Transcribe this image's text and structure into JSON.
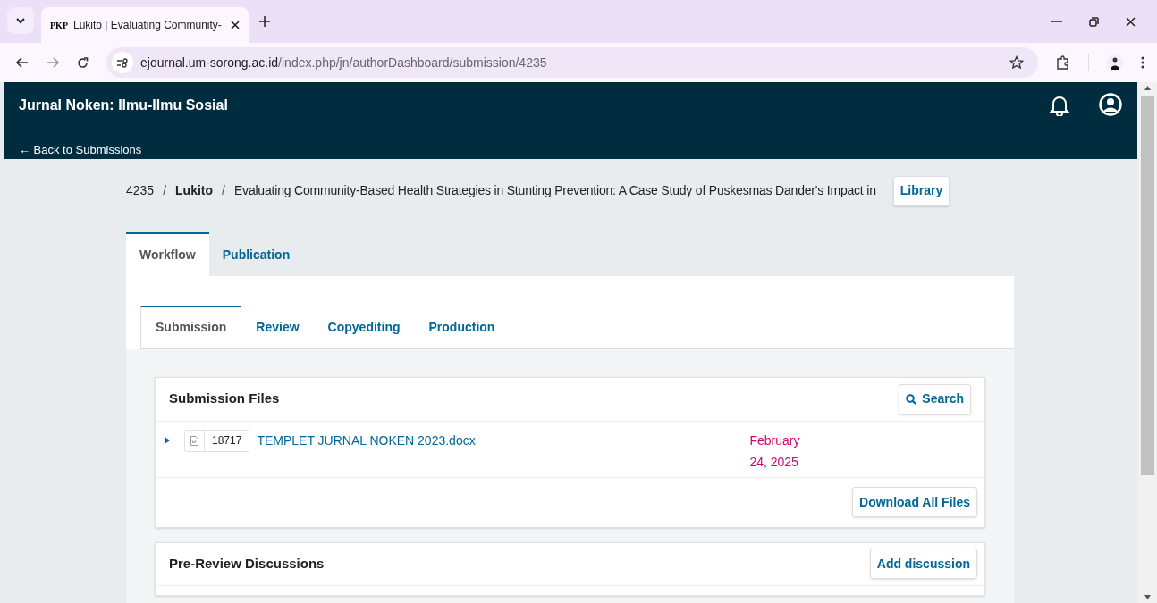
{
  "browser": {
    "tab_title": "Lukito | Evaluating Community-",
    "favicon_text": "PKP",
    "url_host": "ejournal.um-sorong.ac.id",
    "url_path": "/index.php/jn/authorDashboard/submission/4235"
  },
  "header": {
    "journal": "Jurnal Noken: Ilmu-Ilmu Sosial",
    "back_link": "← Back to Submissions"
  },
  "breadcrumb": {
    "separator": "/",
    "id": "4235",
    "author": "Lukito",
    "title": "Evaluating Community-Based Health Strategies in Stunting Prevention: A Case Study of Puskesmas Dander's Impact in",
    "library_button": "Library"
  },
  "main_tabs": [
    {
      "label": "Workflow",
      "selected": true
    },
    {
      "label": "Publication",
      "selected": false
    }
  ],
  "stage_tabs": [
    {
      "label": "Submission",
      "selected": true
    },
    {
      "label": "Review",
      "selected": false
    },
    {
      "label": "Copyediting",
      "selected": false
    },
    {
      "label": "Production",
      "selected": false
    }
  ],
  "submission_files": {
    "title": "Submission Files",
    "search_button": "Search",
    "files": [
      {
        "expanded": false,
        "id": "18717",
        "name": "TEMPLET JURNAL NOKEN 2023.docx",
        "date": "February 24, 2025"
      }
    ],
    "download_button": "Download All Files"
  },
  "discussions": {
    "title": "Pre-Review Discussions",
    "add_button": "Add discussion"
  }
}
